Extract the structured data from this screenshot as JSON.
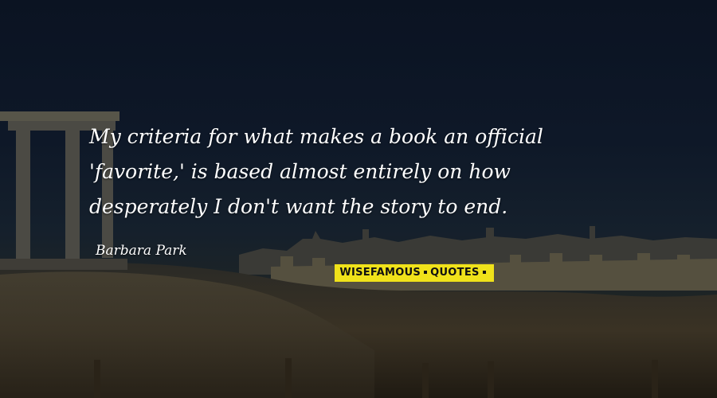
{
  "quote": {
    "lines": [
      "My criteria for what makes a book an official",
      "'favorite,' is based almost entirely on how",
      "desperately I don't want the story to end."
    ],
    "author": "Barbara Park"
  },
  "watermark": {
    "left": "WISEFAMOUS",
    "right": "QUOTES",
    "background_color": "#f0e21a",
    "text_color": "#111111"
  },
  "colors": {
    "sky": "#0d1524",
    "ground": "#221f18",
    "text": "#ffffff"
  }
}
